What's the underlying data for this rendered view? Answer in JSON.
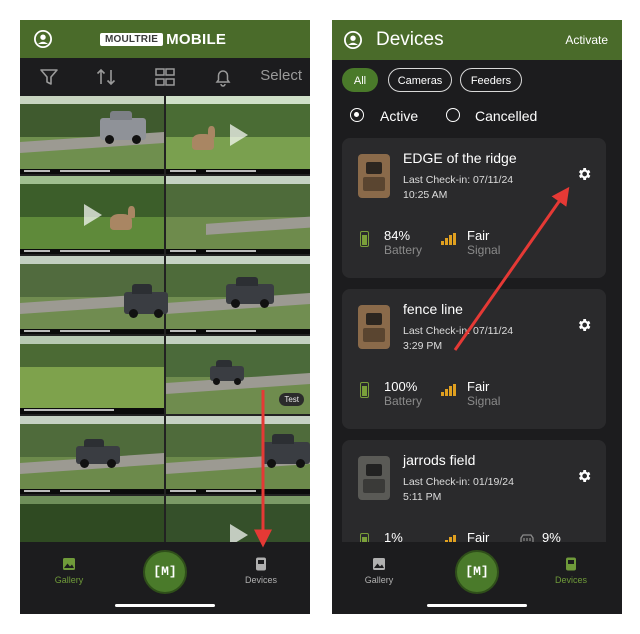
{
  "colors": {
    "header_green": "#4a6b2a",
    "accent_green": "#4a7a2a",
    "annotation_red": "#e53935",
    "background": "#1c1c1e"
  },
  "left": {
    "brand": {
      "box_text": "MOULTRIE",
      "text": "MOBILE"
    },
    "toolbar": {
      "filter_icon": "filter-icon",
      "sort_icon": "sort-icon",
      "grid_icon": "grid-view-icon",
      "bell_icon": "bell-icon",
      "select_label": "Select"
    },
    "photos": [
      {
        "scene": "truck on gravel road"
      },
      {
        "scene": "deer at forest edge"
      },
      {
        "scene": "deer in woods"
      },
      {
        "scene": "field and road"
      },
      {
        "scene": "empty road"
      },
      {
        "scene": "truck on road"
      },
      {
        "scene": "truck on road"
      },
      {
        "scene": "truck on road"
      },
      {
        "scene": "cornfield"
      },
      {
        "scene": "truck on road",
        "badge": "Test"
      },
      {
        "scene": "truck on road"
      },
      {
        "scene": "truck on road"
      },
      {
        "scene": "woods"
      },
      {
        "scene": "woods"
      }
    ],
    "nav": {
      "gallery": "Gallery",
      "center": "[M]",
      "devices": "Devices"
    }
  },
  "right": {
    "header": {
      "title": "Devices",
      "action": "Activate"
    },
    "filters": [
      "All",
      "Cameras",
      "Feeders"
    ],
    "status": {
      "active": "Active",
      "cancelled": "Cancelled"
    },
    "devices": [
      {
        "name": "EDGE of the ridge",
        "checkin_label": "Last Check-in:",
        "checkin_date": "07/11/24",
        "checkin_time": "10:25 AM",
        "battery": "84%",
        "battery_label": "Battery",
        "signal": "Fair",
        "signal_label": "Signal",
        "camera_color": "#8a6a4a"
      },
      {
        "name": "fence line",
        "checkin_label": "Last Check-in:",
        "checkin_date": "07/11/24",
        "checkin_time": "3:29 PM",
        "battery": "100%",
        "battery_label": "Battery",
        "signal": "Fair",
        "signal_label": "Signal",
        "camera_color": "#8a6a4a"
      },
      {
        "name": "jarrods field",
        "checkin_label": "Last Check-in:",
        "checkin_date": "01/19/24",
        "checkin_time": "5:11 PM",
        "battery": "1%",
        "signal": "Fair",
        "storage": "9%",
        "camera_color": "#5a5a56"
      }
    ],
    "nav": {
      "gallery": "Gallery",
      "center": "[M]",
      "devices": "Devices"
    }
  }
}
